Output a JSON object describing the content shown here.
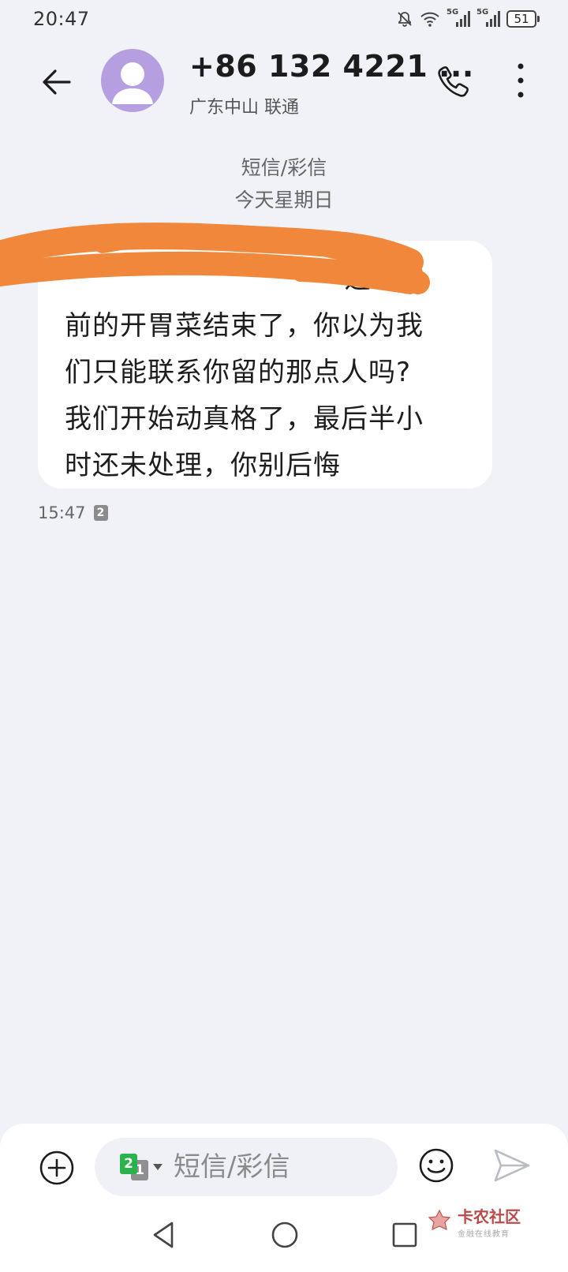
{
  "status_bar": {
    "time": "20:47",
    "signal_1_label": "5G",
    "signal_2_label": "5G",
    "battery": "51"
  },
  "header": {
    "contact_name": "+86 132 4221 ...",
    "contact_sub": "广东中山 联通"
  },
  "conversation": {
    "message_type": "短信/彩信",
    "date_label": "今天星期日",
    "messages": [
      {
        "text": "                              之\n前的开胃菜结束了，你以为我\n们只能联系你留的那点人吗?\n我们开始动真格了，最后半小\n时还未处理，你别后悔",
        "time": "15:47",
        "sim": "2"
      }
    ]
  },
  "composer": {
    "sim_front": "2",
    "sim_back": "1",
    "placeholder": "短信/彩信"
  },
  "colors": {
    "background": "#f1f2f7",
    "avatar": "#b59fe0",
    "redaction": "#f0873a",
    "sim_green": "#2bb24c"
  },
  "watermark": {
    "title": "卡农社区",
    "subtitle": "金融在线教育"
  }
}
